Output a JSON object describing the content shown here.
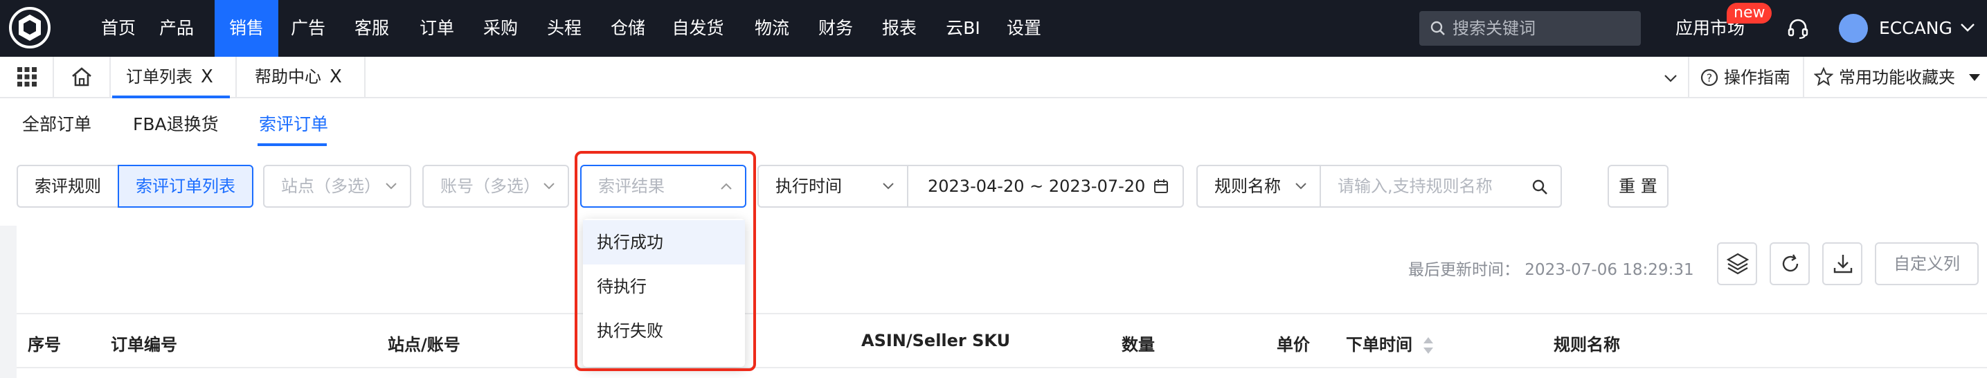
{
  "nav": {
    "items": [
      "首页",
      "产品",
      "销售",
      "广告",
      "客服",
      "订单",
      "采购",
      "头程",
      "仓储",
      "自发货",
      "物流",
      "财务",
      "报表",
      "云BI",
      "设置"
    ],
    "active": "销售",
    "search_placeholder": "搜索关键词",
    "app_market": "应用市场",
    "new_badge": "new",
    "user": "ECCANG"
  },
  "tabs": {
    "items": [
      {
        "label": "订单列表",
        "close": "X"
      },
      {
        "label": "帮助中心",
        "close": "X"
      }
    ],
    "guide": "操作指南",
    "favorites": "常用功能收藏夹"
  },
  "subtabs": {
    "items": [
      "全部订单",
      "FBA退换货",
      "索评订单"
    ],
    "active": "索评订单"
  },
  "filters": {
    "seg_rules": "索评规则",
    "seg_list": "索评订单列表",
    "site_placeholder": "站点（多选）",
    "account_placeholder": "账号（多选）",
    "result_placeholder": "索评结果",
    "time_type": "执行时间",
    "date_range": "2023-04-20 ~ 2023-07-20",
    "rule_field": "规则名称",
    "rule_placeholder": "请输入,支持规则名称",
    "reset": "重 置"
  },
  "dropdown": {
    "options": [
      "执行成功",
      "待执行",
      "执行失败"
    ],
    "highlighted": "执行成功"
  },
  "panel": {
    "last_updated": "最后更新时间： 2023-07-06 18:29:31",
    "custom_columns": "自定义列"
  },
  "table": {
    "headers": [
      "序号",
      "订单编号",
      "站点/账号",
      "ASIN/Seller SKU",
      "数量",
      "单价",
      "下单时间",
      "规则名称"
    ]
  },
  "colors": {
    "accent": "#1a6dff",
    "nav_bg": "#171b25",
    "highlight_frame": "#ee2b1a"
  }
}
